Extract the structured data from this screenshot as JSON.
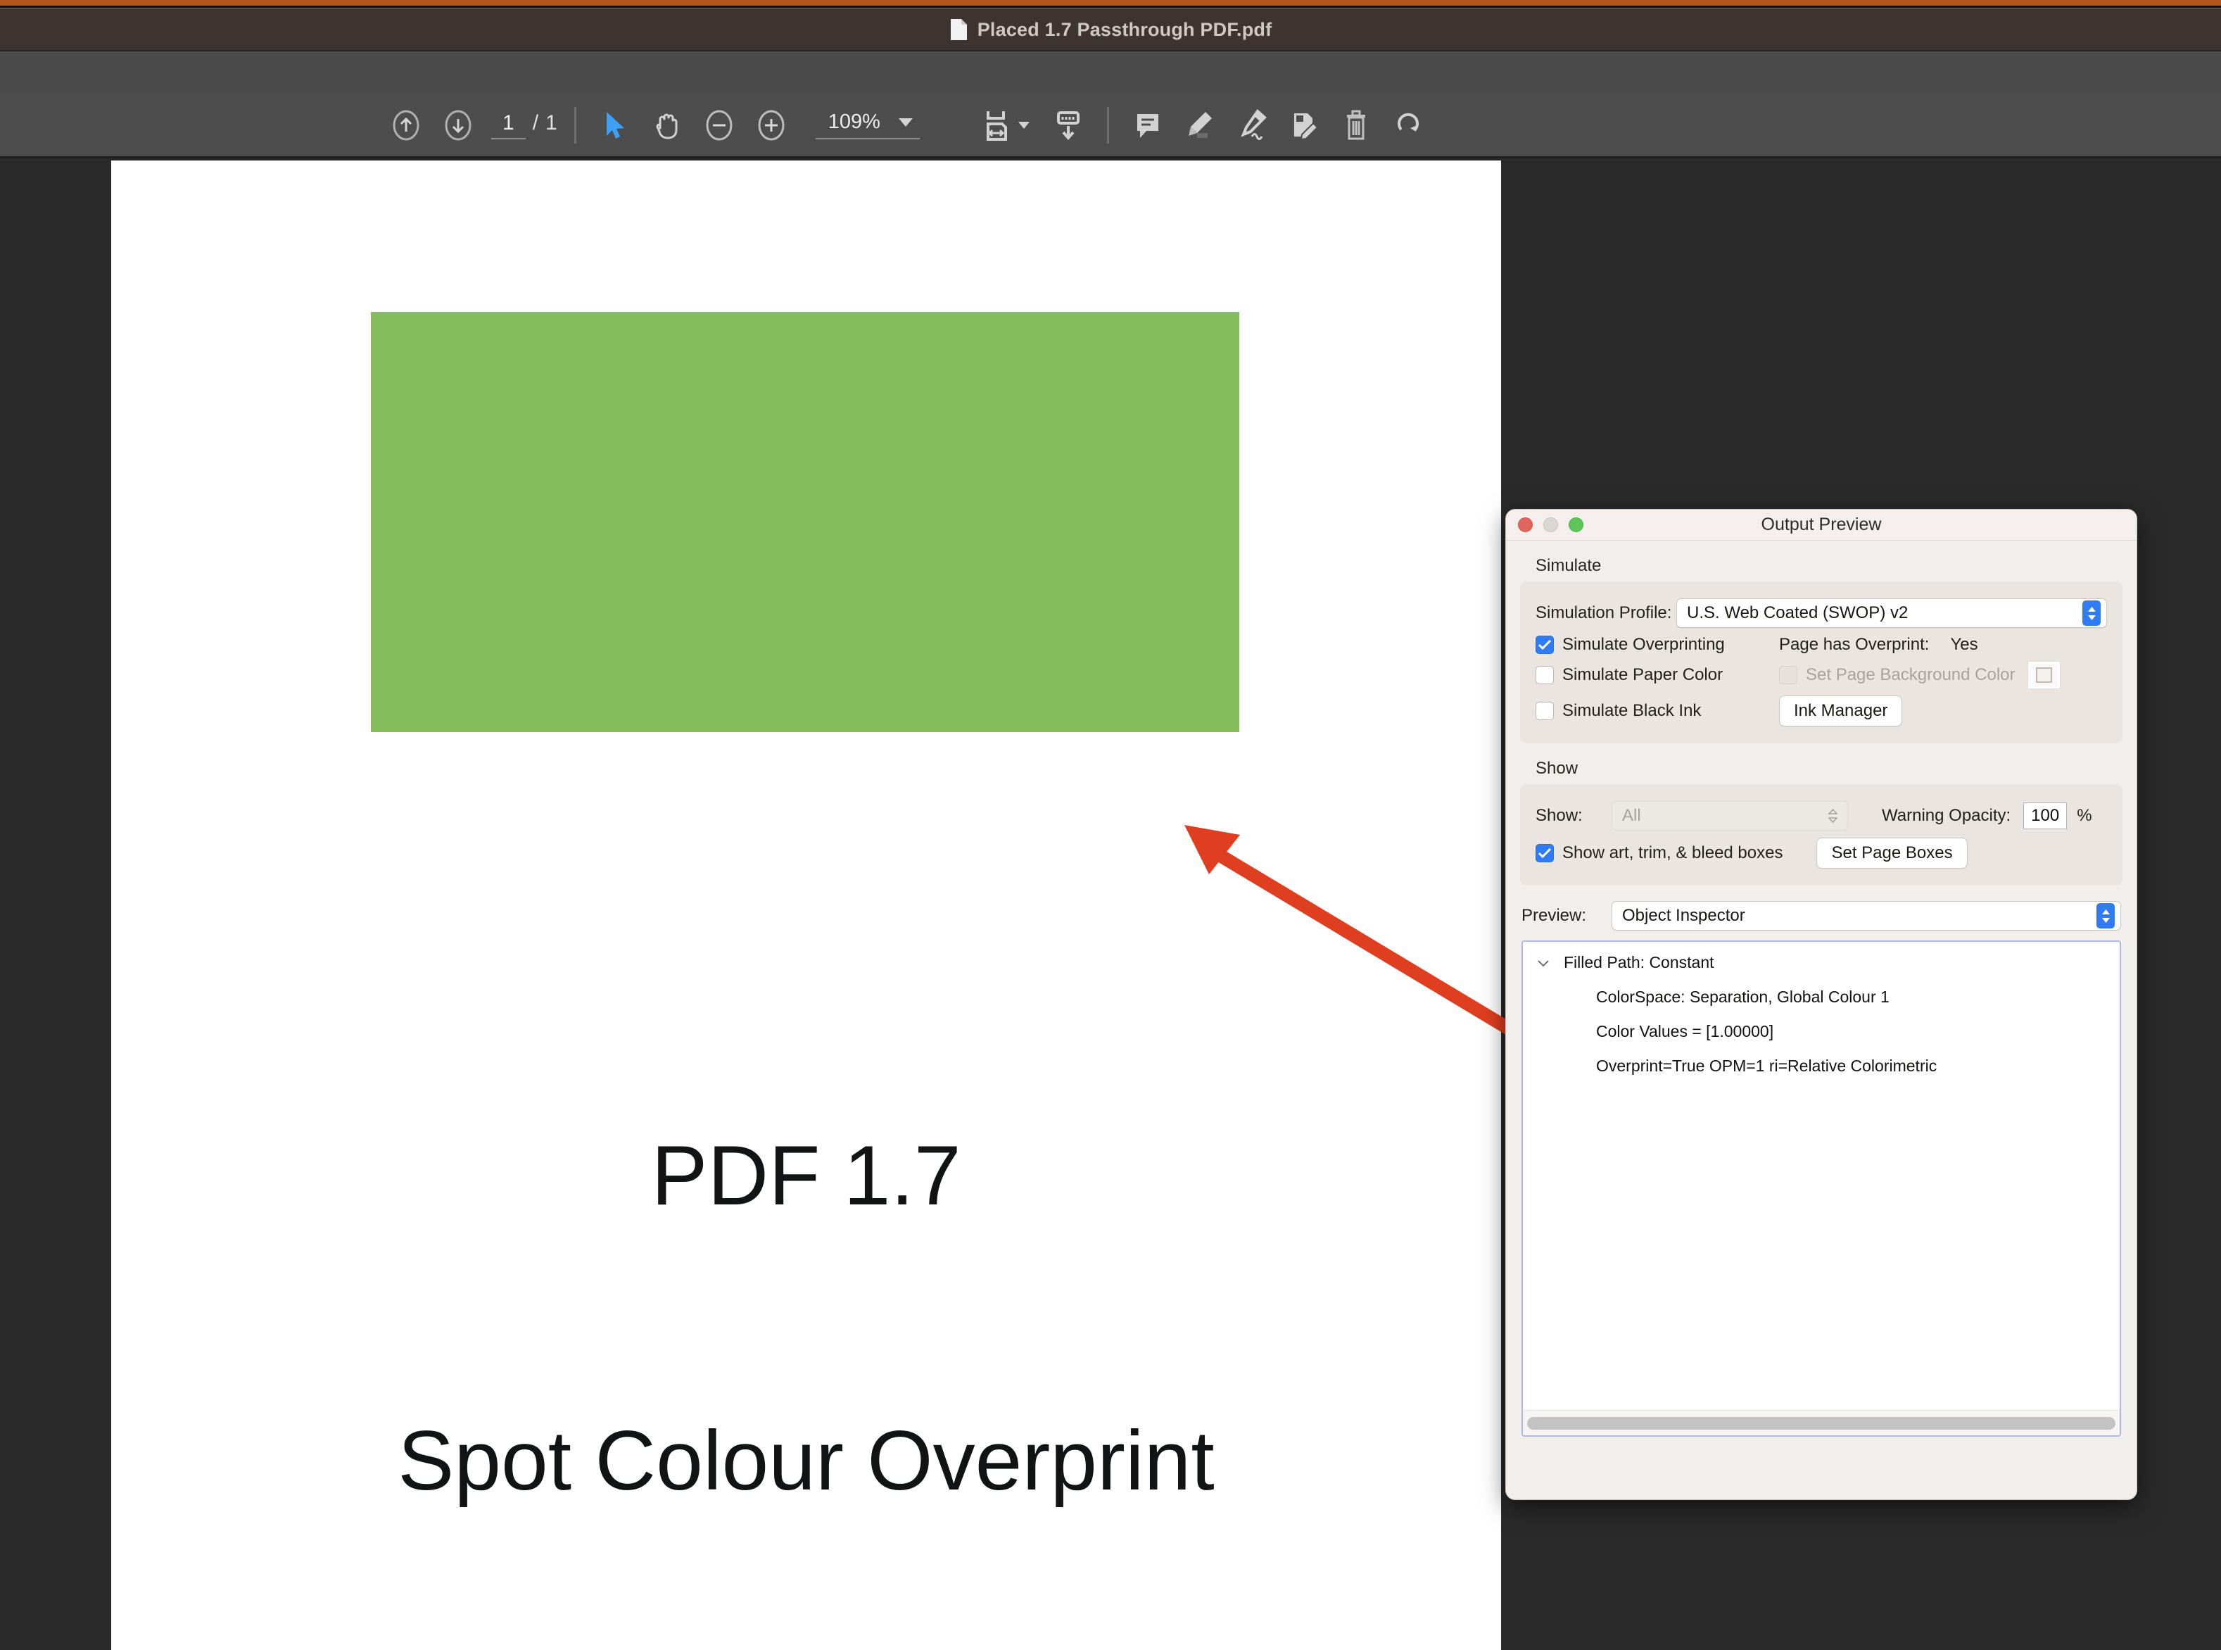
{
  "window": {
    "title": "Placed 1.7 Passthrough PDF.pdf",
    "doc_icon": "document-icon"
  },
  "toolbar": {
    "prev_page_icon": "arrow-up-circle-icon",
    "next_page_icon": "arrow-down-circle-icon",
    "page_current": "1",
    "page_separator": "/",
    "page_total": "1",
    "select_tool_icon": "cursor-arrow-icon",
    "hand_tool_icon": "hand-icon",
    "zoom_out_icon": "minus-circle-icon",
    "zoom_in_icon": "plus-circle-icon",
    "zoom_value": "109%",
    "zoom_dropdown_icon": "chevron-down-icon",
    "fit_page_icon": "fit-width-icon",
    "fit_page_dropdown_icon": "chevron-down-icon",
    "download_icon": "download-icon",
    "comment_icon": "comment-icon",
    "highlight_icon": "highlighter-icon",
    "sign_icon": "signature-pen-icon",
    "edit_icon": "edit-document-icon",
    "delete_icon": "trash-icon",
    "rotate_icon": "rotate-icon"
  },
  "document": {
    "heading": "PDF 1.7",
    "subheading": "Spot Colour Overprint",
    "rect_color": "#85bd58",
    "annotation_arrow_color": "#e03e20"
  },
  "output_preview": {
    "title": "Output Preview",
    "traffic_lights": {
      "close": "close-window-button",
      "minimize": "minimize-window-button",
      "zoom": "zoom-window-button"
    },
    "simulate": {
      "section_label": "Simulate",
      "profile_label": "Simulation Profile:",
      "profile_value": "U.S. Web Coated (SWOP) v2",
      "simulate_overprinting_label": "Simulate Overprinting",
      "simulate_overprinting_checked": true,
      "page_has_overprint_label": "Page has Overprint:",
      "page_has_overprint_value": "Yes",
      "simulate_paper_color_label": "Simulate Paper Color",
      "simulate_paper_color_checked": false,
      "set_page_background_label": "Set Page Background Color",
      "set_page_background_checked": false,
      "simulate_black_ink_label": "Simulate Black Ink",
      "simulate_black_ink_checked": false,
      "ink_manager_label": "Ink Manager"
    },
    "show": {
      "section_label": "Show",
      "show_label": "Show:",
      "show_value": "All",
      "warning_opacity_label": "Warning Opacity:",
      "warning_opacity_value": "100",
      "warning_opacity_unit": "%",
      "show_boxes_label": "Show art, trim, & bleed boxes",
      "show_boxes_checked": true,
      "set_page_boxes_label": "Set Page Boxes"
    },
    "preview": {
      "label": "Preview:",
      "value": "Object Inspector"
    },
    "inspector": {
      "disclosure_icon": "chevron-down-icon",
      "root_label": "Filled Path: Constant",
      "lines": [
        "ColorSpace: Separation, Global Colour 1",
        "Color Values = [1.00000]",
        "Overprint=True OPM=1 ri=Relative Colorimetric"
      ]
    }
  },
  "colors": {
    "accent_strip": "#b2561d",
    "titlebar": "#3d3431",
    "toolbar": "#4d4d4d",
    "workspace": "#2a2a2a",
    "panel": "#f2eeeb",
    "control_blue": "#2f7cf6"
  }
}
